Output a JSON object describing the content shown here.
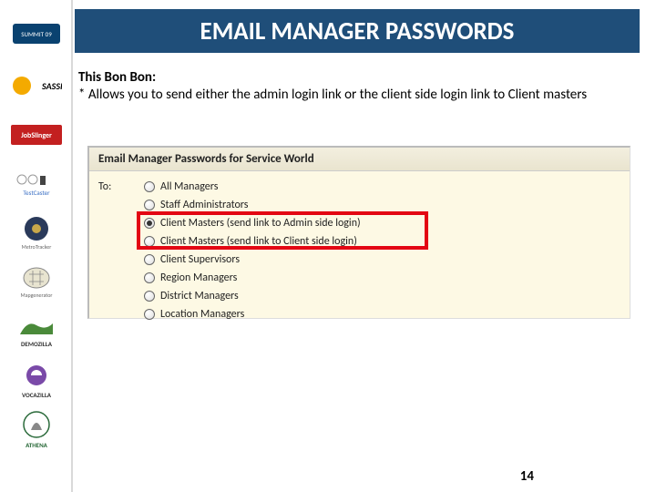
{
  "title": "EMAIL MANAGER PASSWORDS",
  "intro": {
    "lead": "This Bon Bon:",
    "line": "* Allows you to send either the admin login link or the client side login link to Client masters"
  },
  "panel": {
    "heading": "Email Manager Passwords for Service World",
    "to_label": "To:",
    "options": [
      "All Managers",
      "Staff Administrators",
      "Client Masters (send link to Admin side login)",
      "Client Masters (send link to Client side login)",
      "Client Supervisors",
      "Region Managers",
      "District Managers",
      "Location Managers"
    ],
    "selected_index": 2
  },
  "page_number": "14",
  "sidebar_logos": [
    "summit-logo",
    "sassie-logo",
    "jobslinger-logo",
    "testcaster-logo",
    "metrotracker-logo",
    "mapgenerator-logo",
    "demozilla-logo",
    "vocazilla-logo",
    "athena-logo"
  ]
}
